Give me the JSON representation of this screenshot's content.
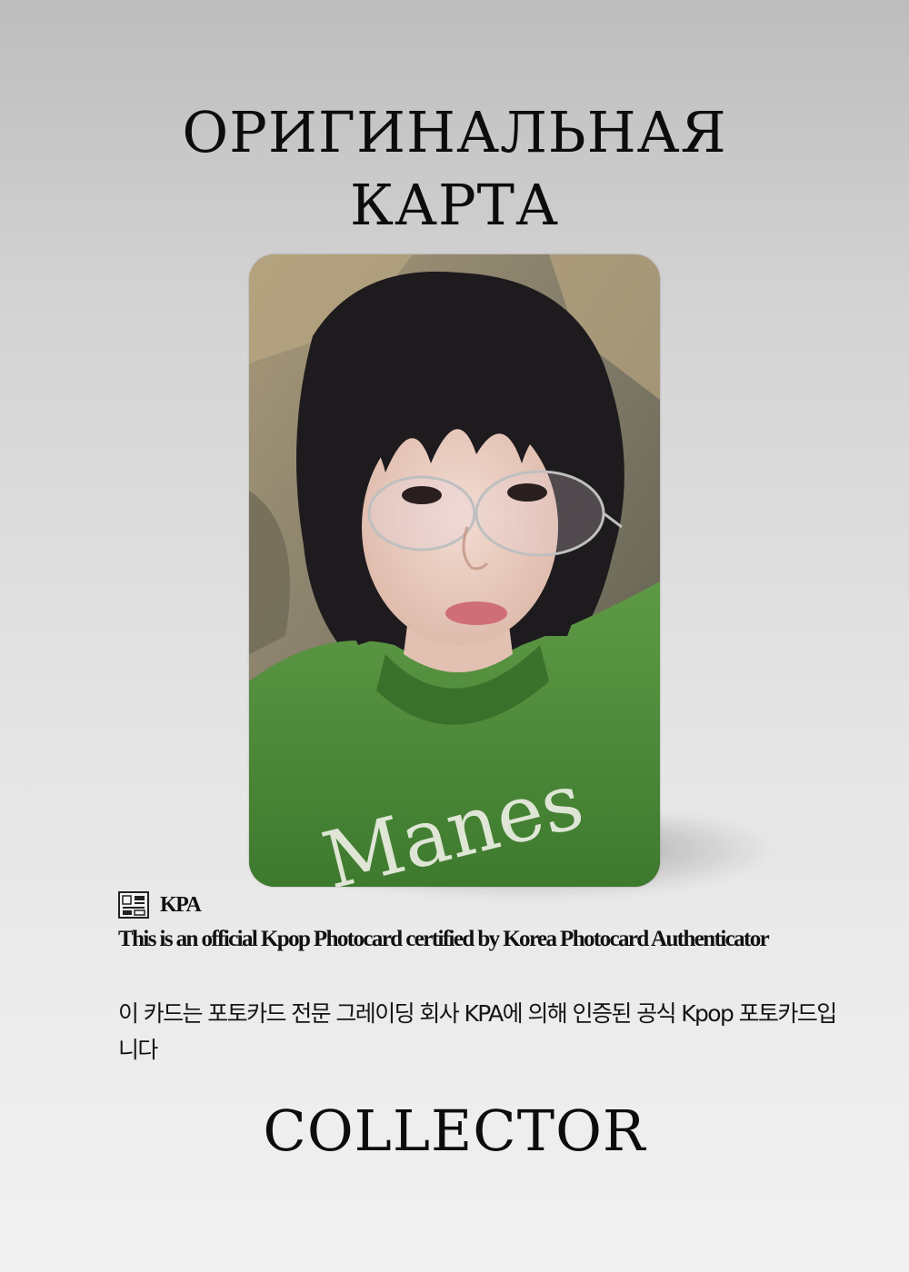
{
  "header": {
    "title_line1": "ОРИГИНАЛЬНАЯ",
    "title_line2": "КАРТА"
  },
  "card": {
    "image_icon": "photocard-portrait-image",
    "colors": {
      "sweater": "#4f8a3a",
      "hair": "#1c1a1c",
      "background": "#8c8371"
    }
  },
  "certification": {
    "logo_icon": "kpa-seal-icon",
    "brand": "KPA",
    "english_text": "This is an official Kpop Photocard certified by Korea Photocard Authenticator",
    "korean_text": "이 카드는 포토카드 전문 그레이딩 회사 KPA에 의해 인증된 공식 Kpop 포토카드입니다"
  },
  "footer": {
    "label": "COLLECTOR"
  }
}
